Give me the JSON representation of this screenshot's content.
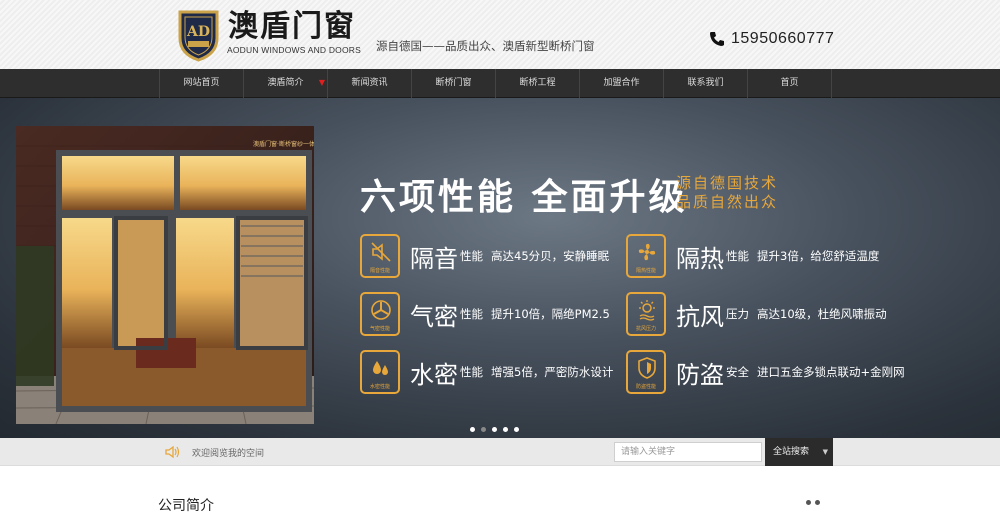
{
  "header": {
    "logo_text": "澳盾门窗",
    "logo_badge_text": "澳盾门窗",
    "logo_en": "AODUN WINDOWS AND DOORS",
    "slogan": "源自德国——品质出众、澳盾新型断桥门窗",
    "phone": "15950660777"
  },
  "nav": {
    "items": [
      {
        "label": "网站首页"
      },
      {
        "label": "澳盾简介"
      },
      {
        "label": "新闻资讯"
      },
      {
        "label": "断桥门窗"
      },
      {
        "label": "断桥工程"
      },
      {
        "label": "加盟合作"
      },
      {
        "label": "联系我们"
      },
      {
        "label": "首页"
      }
    ]
  },
  "banner": {
    "photo_label": "澳盾门窗·断桥窗纱一体",
    "headline": "六项性能 全面升级",
    "sub1": "源自德国技术",
    "sub2": "品质自然出众",
    "features": [
      {
        "title": "隔音",
        "suffix": "性能",
        "desc": "高达45分贝，安静睡眠",
        "icon_label": "隔音性能",
        "icon": "mute-icon"
      },
      {
        "title": "隔热",
        "suffix": "性能",
        "desc": "提升3倍，给您舒适温度",
        "icon_label": "隔热性能",
        "icon": "fan-icon"
      },
      {
        "title": "气密",
        "suffix": "性能",
        "desc": "提升10倍，隔绝PM2.5",
        "icon_label": "气密性能",
        "icon": "air-icon"
      },
      {
        "title": "抗风",
        "suffix": "压力",
        "desc": "高达10级，杜绝风啸振动",
        "icon_label": "抗风压力",
        "icon": "sun-wind-icon"
      },
      {
        "title": "水密",
        "suffix": "性能",
        "desc": "增强5倍，严密防水设计",
        "icon_label": "水密性能",
        "icon": "water-drop-icon"
      },
      {
        "title": "防盗",
        "suffix": "安全",
        "desc": "进口五金多锁点联动+金刚网",
        "icon_label": "防盗性能",
        "icon": "shield-icon"
      }
    ]
  },
  "notice": {
    "text": "欢迎阅览我的空间"
  },
  "search": {
    "placeholder": "请输入关键字",
    "button_label": "全站搜索"
  },
  "section": {
    "title": "公司简介"
  },
  "colors": {
    "accent": "#e8a73a",
    "nav_bg": "#2e2e2e"
  }
}
